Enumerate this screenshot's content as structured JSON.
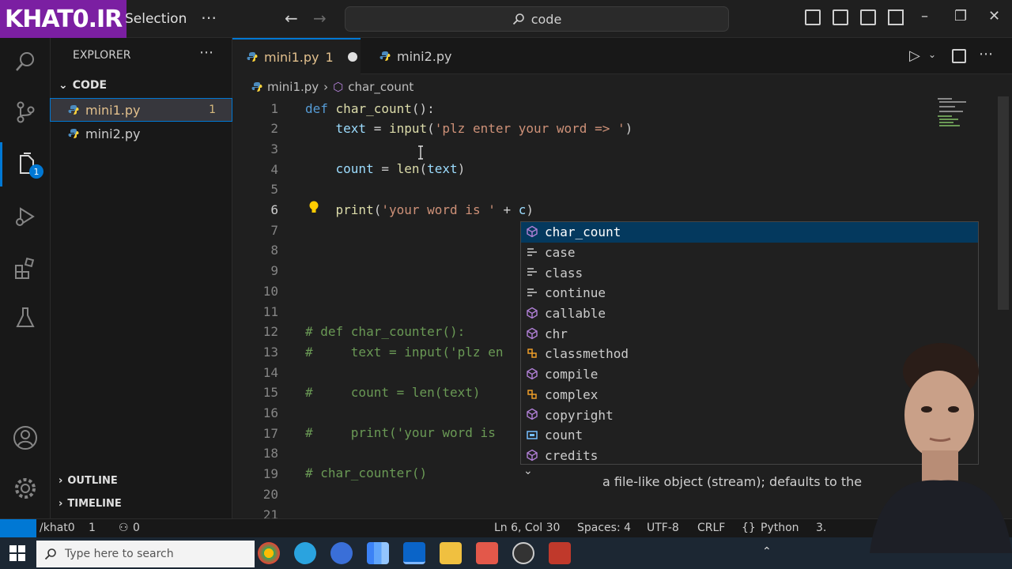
{
  "titlebar": {
    "logo": "KHAT0.IR",
    "menu_selection": "Selection",
    "search": "code"
  },
  "sidebar": {
    "title": "EXPLORER",
    "folder": "CODE",
    "files": [
      {
        "name": "mini1.py",
        "problems": "1"
      },
      {
        "name": "mini2.py",
        "problems": ""
      }
    ],
    "outline": "OUTLINE",
    "timeline": "TIMELINE"
  },
  "activity_badge": "1",
  "tabs": [
    {
      "label": "mini1.py",
      "problems": "1"
    },
    {
      "label": "mini2.py"
    }
  ],
  "breadcrumb": {
    "file": "mini1.py",
    "symbol": "char_count"
  },
  "editor": {
    "line_numbers": [
      "1",
      "2",
      "3",
      "4",
      "5",
      "6",
      "7",
      "8",
      "9",
      "10",
      "11",
      "12",
      "13",
      "14",
      "15",
      "16",
      "17",
      "18",
      "19",
      "20",
      "21"
    ],
    "l12": "# def char_counter():",
    "l13": "#     text = input('plz en",
    "l15": "#     count = len(text)",
    "l17": "#     print('your word is ",
    "l19": "# char_counter()"
  },
  "suggest": {
    "items": [
      "char_count",
      "case",
      "class",
      "continue",
      "callable",
      "chr",
      "classmethod",
      "compile",
      "complex",
      "copyright",
      "count",
      "credits"
    ],
    "doc": "a file-like object (stream); defaults to the"
  },
  "status": {
    "remote_user": "/khat0",
    "problems": "1",
    "warnings": "0",
    "position": "Ln 6, Col 30",
    "spaces": "Spaces: 4",
    "encoding": "UTF-8",
    "eol": "CRLF",
    "language": "Python",
    "version": "3."
  },
  "taskbar": {
    "search_placeholder": "Type here to search"
  },
  "colors": {
    "accent": "#0078d4",
    "keyword": "#569cd6",
    "function": "#dcdcaa",
    "string": "#ce9178",
    "comment": "#6a9955"
  }
}
